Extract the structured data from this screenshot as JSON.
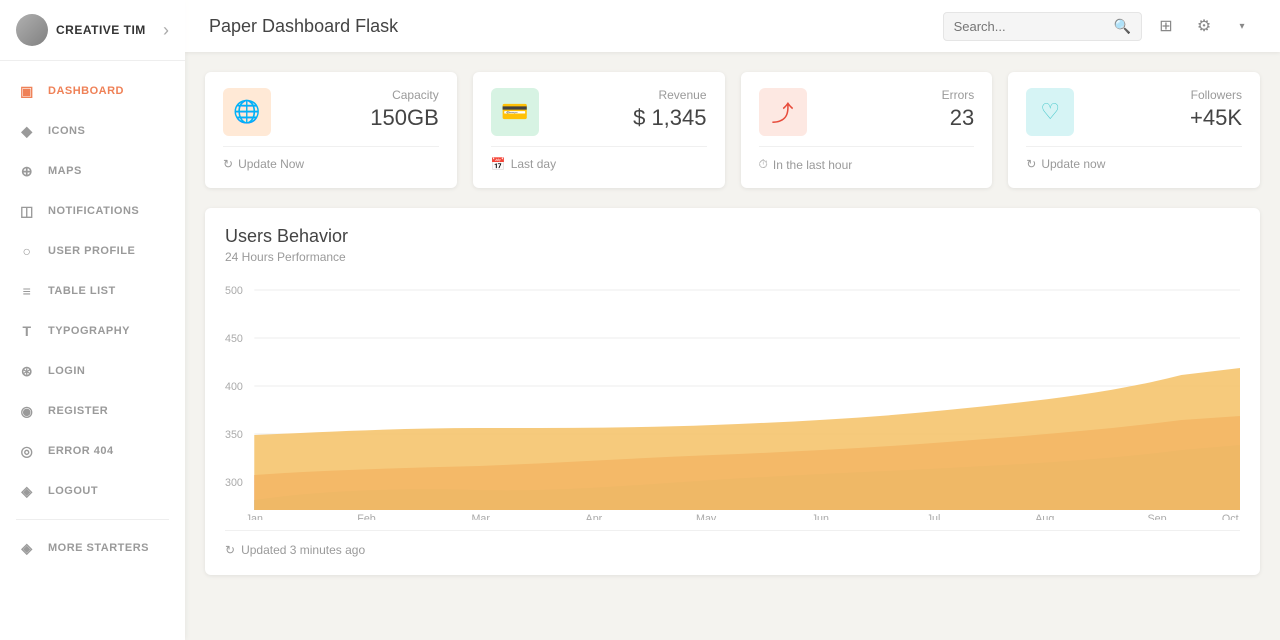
{
  "brand": {
    "name": "CREATIVE TIM"
  },
  "sidebar": {
    "items": [
      {
        "id": "dashboard",
        "label": "DASHBOARD",
        "icon": "⊞",
        "active": true
      },
      {
        "id": "icons",
        "label": "ICONS",
        "icon": "✦",
        "active": false
      },
      {
        "id": "maps",
        "label": "MAPS",
        "icon": "◎",
        "active": false
      },
      {
        "id": "notifications",
        "label": "NOTIFICATIONS",
        "icon": "🔔",
        "active": false
      },
      {
        "id": "user-profile",
        "label": "USER PROFILE",
        "icon": "👤",
        "active": false
      },
      {
        "id": "table-list",
        "label": "TABLE LIST",
        "icon": "☰",
        "active": false
      },
      {
        "id": "typography",
        "label": "TYPOGRAPHY",
        "icon": "T",
        "active": false
      },
      {
        "id": "login",
        "label": "LOGIN",
        "icon": "◎",
        "active": false
      },
      {
        "id": "register",
        "label": "REGISTER",
        "icon": "⊙",
        "active": false
      },
      {
        "id": "error-404",
        "label": "ERROR 404",
        "icon": "⊙",
        "active": false
      },
      {
        "id": "logout",
        "label": "LOGOUT",
        "icon": "✦",
        "active": false
      },
      {
        "id": "more-starters",
        "label": "MORE STARTERS",
        "icon": "✦",
        "active": false
      }
    ]
  },
  "header": {
    "title": "Paper Dashboard Flask",
    "search_placeholder": "Search..."
  },
  "stats": [
    {
      "id": "capacity",
      "label": "Capacity",
      "value": "150GB",
      "icon_type": "orange",
      "icon": "🌐",
      "footer": "Update Now",
      "footer_icon": "↻"
    },
    {
      "id": "revenue",
      "label": "Revenue",
      "value": "$ 1,345",
      "icon_type": "green",
      "icon": "💳",
      "footer": "Last day",
      "footer_icon": "📅"
    },
    {
      "id": "errors",
      "label": "Errors",
      "value": "23",
      "icon_type": "coral",
      "icon": "⤴",
      "footer": "In the last hour",
      "footer_icon": "⏱"
    },
    {
      "id": "followers",
      "label": "Followers",
      "value": "+45K",
      "icon_type": "teal",
      "icon": "♡",
      "footer": "Update now",
      "footer_icon": "↻"
    }
  ],
  "chart": {
    "title": "Users Behavior",
    "subtitle": "24 Hours Performance",
    "footer": "Updated 3 minutes ago",
    "footer_icon": "↻",
    "y_labels": [
      "500",
      "450",
      "400",
      "350",
      "300"
    ],
    "x_labels": [
      "Jan",
      "Feb",
      "Mar",
      "Apr",
      "May",
      "Jun",
      "Jul",
      "Aug",
      "Sep",
      "Oct"
    ],
    "colors": {
      "top": "#f4c165",
      "mid": "#e8725a",
      "bot": "#5fcfad"
    }
  }
}
